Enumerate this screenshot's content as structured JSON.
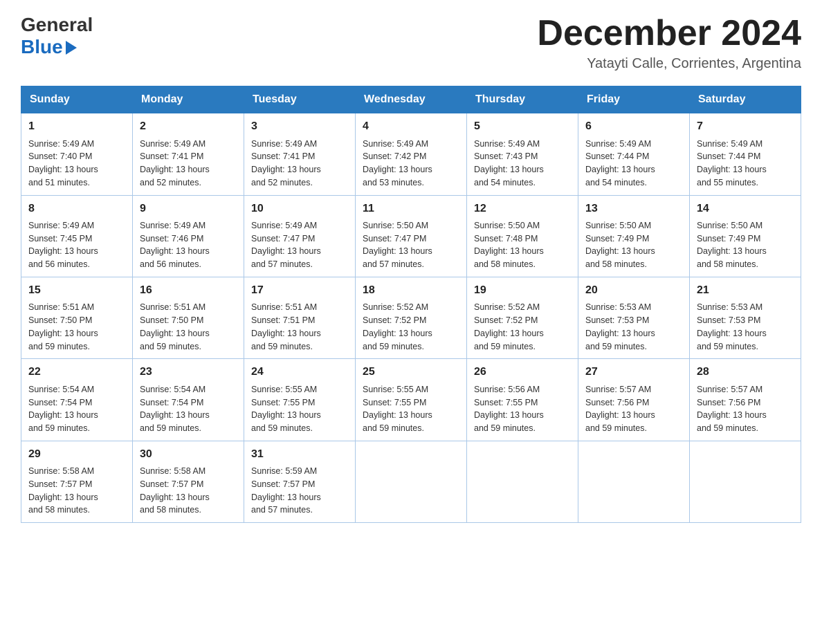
{
  "header": {
    "logo_general": "General",
    "logo_blue": "Blue",
    "month_title": "December 2024",
    "location": "Yatayti Calle, Corrientes, Argentina"
  },
  "days_of_week": [
    "Sunday",
    "Monday",
    "Tuesday",
    "Wednesday",
    "Thursday",
    "Friday",
    "Saturday"
  ],
  "weeks": [
    [
      {
        "day": "1",
        "sunrise": "5:49 AM",
        "sunset": "7:40 PM",
        "daylight": "13 hours and 51 minutes."
      },
      {
        "day": "2",
        "sunrise": "5:49 AM",
        "sunset": "7:41 PM",
        "daylight": "13 hours and 52 minutes."
      },
      {
        "day": "3",
        "sunrise": "5:49 AM",
        "sunset": "7:41 PM",
        "daylight": "13 hours and 52 minutes."
      },
      {
        "day": "4",
        "sunrise": "5:49 AM",
        "sunset": "7:42 PM",
        "daylight": "13 hours and 53 minutes."
      },
      {
        "day": "5",
        "sunrise": "5:49 AM",
        "sunset": "7:43 PM",
        "daylight": "13 hours and 54 minutes."
      },
      {
        "day": "6",
        "sunrise": "5:49 AM",
        "sunset": "7:44 PM",
        "daylight": "13 hours and 54 minutes."
      },
      {
        "day": "7",
        "sunrise": "5:49 AM",
        "sunset": "7:44 PM",
        "daylight": "13 hours and 55 minutes."
      }
    ],
    [
      {
        "day": "8",
        "sunrise": "5:49 AM",
        "sunset": "7:45 PM",
        "daylight": "13 hours and 56 minutes."
      },
      {
        "day": "9",
        "sunrise": "5:49 AM",
        "sunset": "7:46 PM",
        "daylight": "13 hours and 56 minutes."
      },
      {
        "day": "10",
        "sunrise": "5:49 AM",
        "sunset": "7:47 PM",
        "daylight": "13 hours and 57 minutes."
      },
      {
        "day": "11",
        "sunrise": "5:50 AM",
        "sunset": "7:47 PM",
        "daylight": "13 hours and 57 minutes."
      },
      {
        "day": "12",
        "sunrise": "5:50 AM",
        "sunset": "7:48 PM",
        "daylight": "13 hours and 58 minutes."
      },
      {
        "day": "13",
        "sunrise": "5:50 AM",
        "sunset": "7:49 PM",
        "daylight": "13 hours and 58 minutes."
      },
      {
        "day": "14",
        "sunrise": "5:50 AM",
        "sunset": "7:49 PM",
        "daylight": "13 hours and 58 minutes."
      }
    ],
    [
      {
        "day": "15",
        "sunrise": "5:51 AM",
        "sunset": "7:50 PM",
        "daylight": "13 hours and 59 minutes."
      },
      {
        "day": "16",
        "sunrise": "5:51 AM",
        "sunset": "7:50 PM",
        "daylight": "13 hours and 59 minutes."
      },
      {
        "day": "17",
        "sunrise": "5:51 AM",
        "sunset": "7:51 PM",
        "daylight": "13 hours and 59 minutes."
      },
      {
        "day": "18",
        "sunrise": "5:52 AM",
        "sunset": "7:52 PM",
        "daylight": "13 hours and 59 minutes."
      },
      {
        "day": "19",
        "sunrise": "5:52 AM",
        "sunset": "7:52 PM",
        "daylight": "13 hours and 59 minutes."
      },
      {
        "day": "20",
        "sunrise": "5:53 AM",
        "sunset": "7:53 PM",
        "daylight": "13 hours and 59 minutes."
      },
      {
        "day": "21",
        "sunrise": "5:53 AM",
        "sunset": "7:53 PM",
        "daylight": "13 hours and 59 minutes."
      }
    ],
    [
      {
        "day": "22",
        "sunrise": "5:54 AM",
        "sunset": "7:54 PM",
        "daylight": "13 hours and 59 minutes."
      },
      {
        "day": "23",
        "sunrise": "5:54 AM",
        "sunset": "7:54 PM",
        "daylight": "13 hours and 59 minutes."
      },
      {
        "day": "24",
        "sunrise": "5:55 AM",
        "sunset": "7:55 PM",
        "daylight": "13 hours and 59 minutes."
      },
      {
        "day": "25",
        "sunrise": "5:55 AM",
        "sunset": "7:55 PM",
        "daylight": "13 hours and 59 minutes."
      },
      {
        "day": "26",
        "sunrise": "5:56 AM",
        "sunset": "7:55 PM",
        "daylight": "13 hours and 59 minutes."
      },
      {
        "day": "27",
        "sunrise": "5:57 AM",
        "sunset": "7:56 PM",
        "daylight": "13 hours and 59 minutes."
      },
      {
        "day": "28",
        "sunrise": "5:57 AM",
        "sunset": "7:56 PM",
        "daylight": "13 hours and 59 minutes."
      }
    ],
    [
      {
        "day": "29",
        "sunrise": "5:58 AM",
        "sunset": "7:57 PM",
        "daylight": "13 hours and 58 minutes."
      },
      {
        "day": "30",
        "sunrise": "5:58 AM",
        "sunset": "7:57 PM",
        "daylight": "13 hours and 58 minutes."
      },
      {
        "day": "31",
        "sunrise": "5:59 AM",
        "sunset": "7:57 PM",
        "daylight": "13 hours and 57 minutes."
      },
      null,
      null,
      null,
      null
    ]
  ],
  "labels": {
    "sunrise": "Sunrise:",
    "sunset": "Sunset:",
    "daylight": "Daylight:"
  }
}
